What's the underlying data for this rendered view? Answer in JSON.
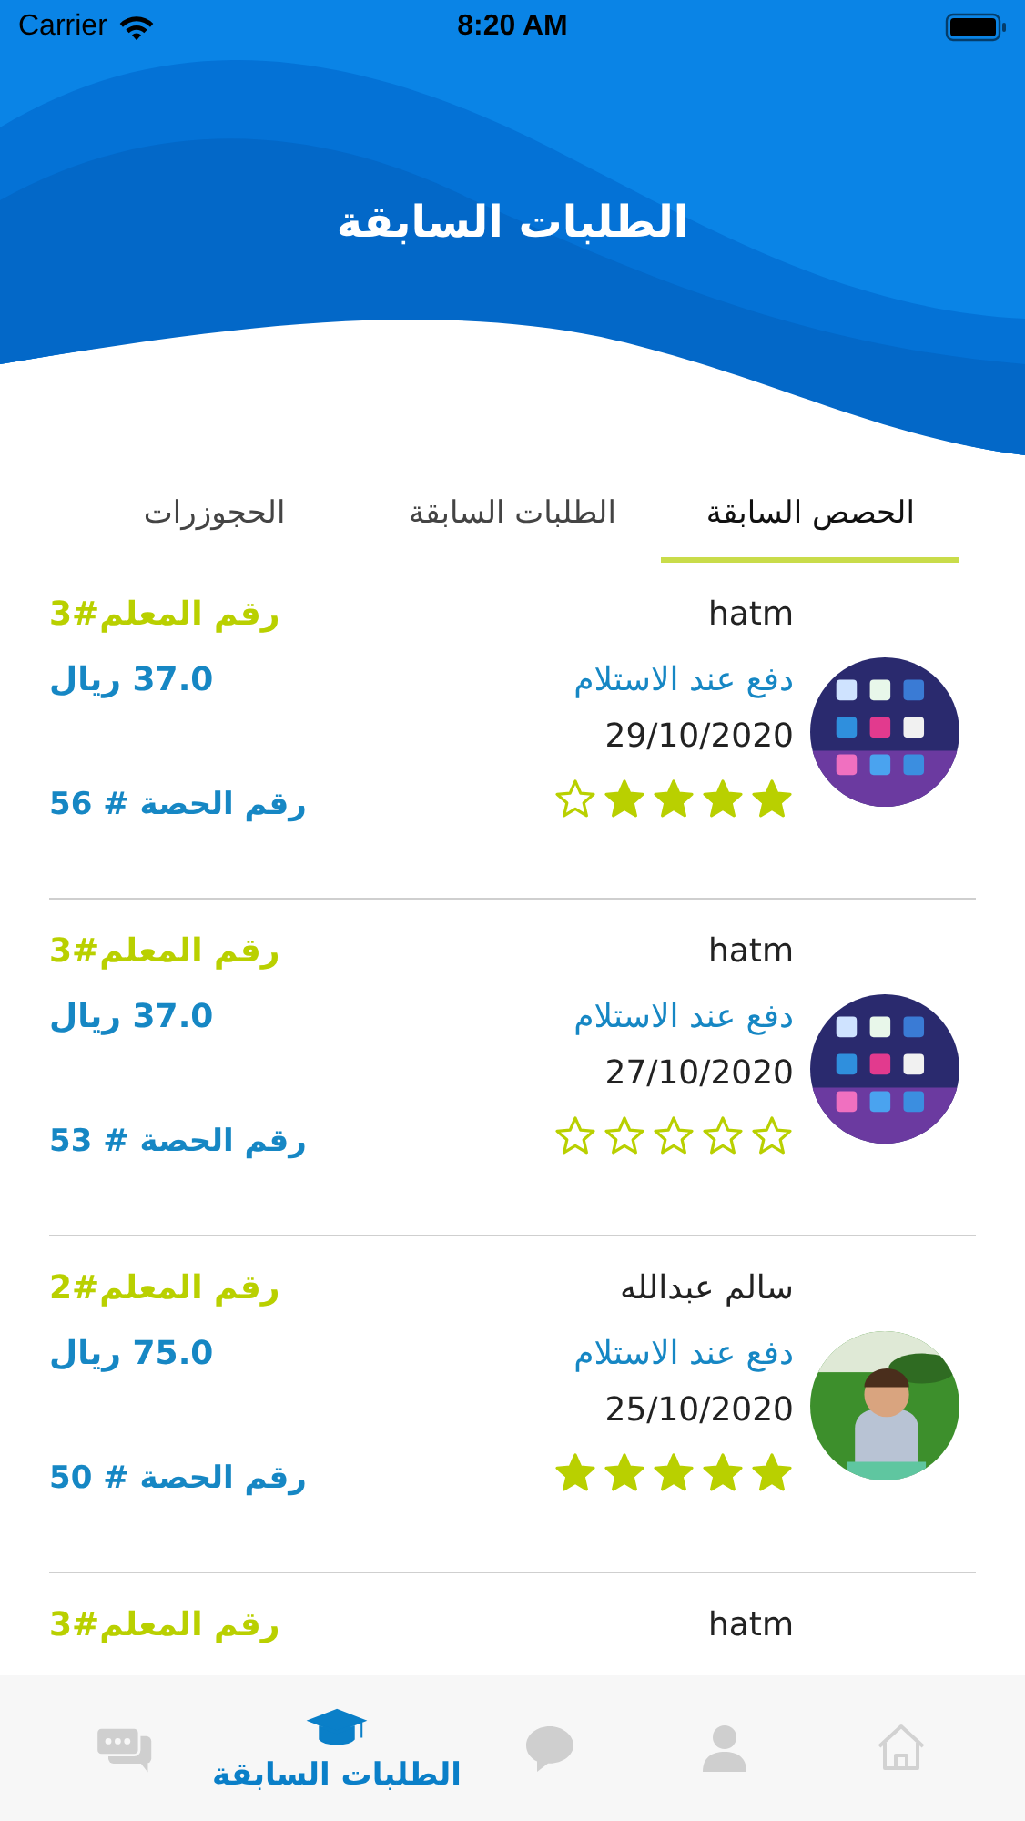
{
  "status_bar": {
    "carrier": "Carrier",
    "time": "8:20 AM"
  },
  "header": {
    "title": "الطلبات السابقة"
  },
  "tabs": [
    {
      "label": "الحصص السابقة",
      "selected": true
    },
    {
      "label": "الطلبات السابقة",
      "selected": false
    },
    {
      "label": "الحجوزرات",
      "selected": false
    }
  ],
  "cards": [
    {
      "name": "hatm",
      "payment": "دفع عند الاستلام",
      "date": "29/10/2020",
      "stars": 4,
      "teacher": "رقم المعلم#3",
      "price": "37.0 ريال",
      "session": "رقم الحصة # 56"
    },
    {
      "name": "hatm",
      "payment": "دفع عند الاستلام",
      "date": "27/10/2020",
      "stars": 0,
      "teacher": "رقم المعلم#3",
      "price": "37.0 ريال",
      "session": "رقم الحصة # 53"
    },
    {
      "name": "سالم عبدالله",
      "payment": "دفع عند الاستلام",
      "date": "25/10/2020",
      "stars": 5,
      "teacher": "رقم المعلم#2",
      "price": "75.0 ريال",
      "session": "رقم الحصة # 50"
    },
    {
      "name": "hatm",
      "teacher": "رقم المعلم#3"
    }
  ],
  "tab_bar": [
    {
      "kind": "home",
      "selected": false
    },
    {
      "kind": "person",
      "selected": false
    },
    {
      "kind": "bubble",
      "selected": false
    },
    {
      "kind": "cap",
      "label": "الطلبات السابقة",
      "selected": true
    },
    {
      "kind": "chats",
      "selected": false
    }
  ]
}
